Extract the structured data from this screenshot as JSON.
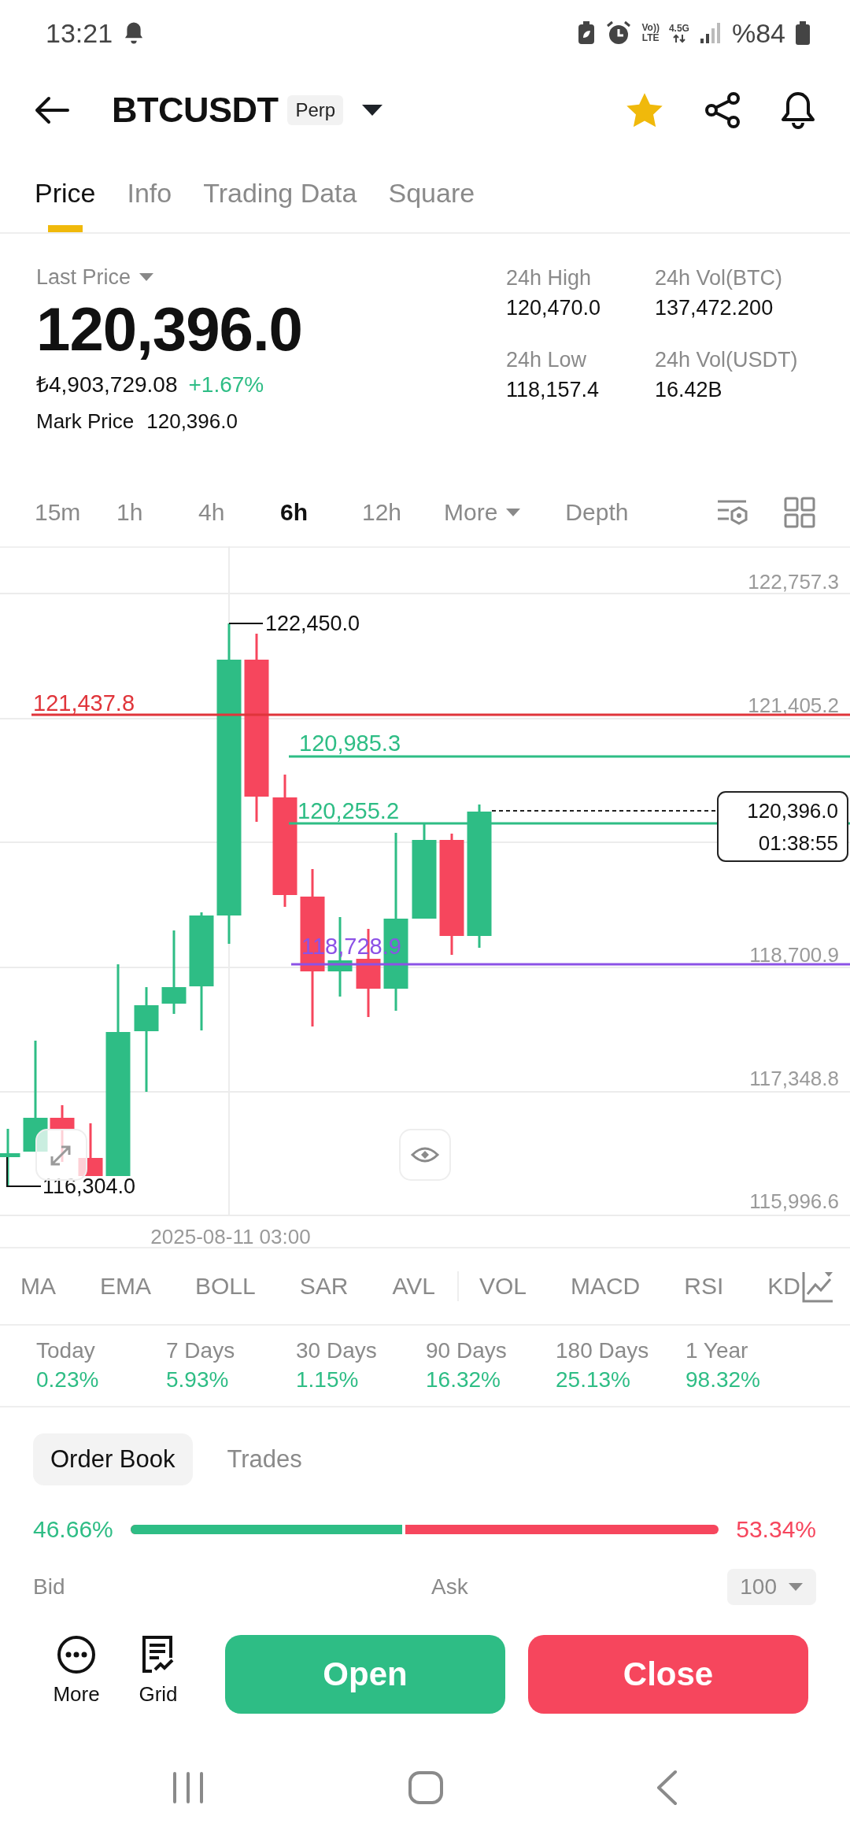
{
  "status_bar": {
    "time": "13:21",
    "volte_top": "Vo))",
    "volte_bottom": "LTE",
    "network_type": "4.5G",
    "battery": "%84"
  },
  "header": {
    "symbol": "BTCUSDT",
    "badge": "Perp",
    "favorite": true
  },
  "tabs": [
    {
      "label": "Price",
      "selected": true
    },
    {
      "label": "Info",
      "selected": false
    },
    {
      "label": "Trading Data",
      "selected": false
    },
    {
      "label": "Square",
      "selected": false
    }
  ],
  "ticker": {
    "last_price_label": "Last Price",
    "last_price": "120,396.0",
    "fiat_price": "₺4,903,729.08",
    "change": "+1.67%",
    "mark_price_label": "Mark Price",
    "mark_price": "120,396.0",
    "stats": [
      {
        "label": "24h High",
        "value": "120,470.0"
      },
      {
        "label": "24h Vol(BTC)",
        "value": "137,472.200"
      },
      {
        "label": "24h Low",
        "value": "118,157.4"
      },
      {
        "label": "24h Vol(USDT)",
        "value": "16.42B"
      }
    ]
  },
  "intervals": [
    {
      "label": "15m",
      "kind": "interval",
      "selected": false
    },
    {
      "label": "1h",
      "kind": "interval",
      "selected": false
    },
    {
      "label": "4h",
      "kind": "interval",
      "selected": false
    },
    {
      "label": "6h",
      "kind": "interval",
      "selected": true
    },
    {
      "label": "12h",
      "kind": "interval",
      "selected": false
    },
    {
      "label": "More",
      "kind": "menu",
      "selected": false
    },
    {
      "label": "Depth",
      "kind": "interval",
      "selected": false
    }
  ],
  "chart": {
    "axis_labels": [
      "122,757.3",
      "121,405.2",
      "118,700.9",
      "117,348.8",
      "115,996.6"
    ],
    "price_lines": [
      {
        "label": "121,437.8",
        "color": "#e0353b"
      },
      {
        "label": "120,985.3",
        "color": "#2ebd85"
      },
      {
        "label": "120,255.2",
        "color": "#2ebd85"
      },
      {
        "label": "118,728.9",
        "color": "#8c52e6"
      }
    ],
    "high_marker": "122,450.0",
    "low_marker": "116,304.0",
    "last_price": "120,396.0",
    "countdown": "01:38:55",
    "time_label": "2025-08-11 03:00"
  },
  "indicators": [
    "MA",
    "EMA",
    "BOLL",
    "SAR",
    "AVL",
    "VOL",
    "MACD",
    "RSI",
    "KD"
  ],
  "returns": [
    {
      "period": "Today",
      "value": "0.23%"
    },
    {
      "period": "7 Days",
      "value": "5.93%"
    },
    {
      "period": "30 Days",
      "value": "1.15%"
    },
    {
      "period": "90 Days",
      "value": "16.32%"
    },
    {
      "period": "180 Days",
      "value": "25.13%"
    },
    {
      "period": "1 Year",
      "value": "98.32%"
    }
  ],
  "order_book": {
    "tabs": [
      {
        "label": "Order Book",
        "selected": true
      },
      {
        "label": "Trades",
        "selected": false
      }
    ],
    "bid_share": "46.66%",
    "ask_share": "53.34%",
    "level": 0.4666,
    "bid_label": "Bid",
    "ask_label": "Ask",
    "depth": "100"
  },
  "actions": {
    "tools": [
      {
        "label": "More",
        "kind": "more"
      },
      {
        "label": "Grid",
        "kind": "grid"
      }
    ],
    "buttons": [
      {
        "label": "Open",
        "kind": "open"
      },
      {
        "label": "Close",
        "kind": "close"
      }
    ]
  }
}
